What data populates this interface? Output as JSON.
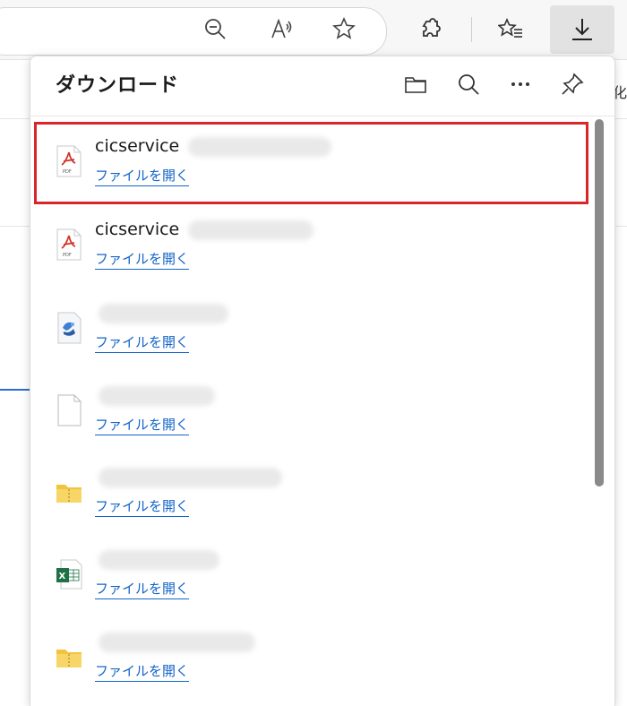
{
  "toolbar": {
    "icons": [
      "zoom-out-icon",
      "read-aloud-icon",
      "favorite-star-icon",
      "extensions-icon",
      "favorites-icon",
      "downloads-icon"
    ]
  },
  "background": {
    "partial_char": "化"
  },
  "panel": {
    "title": "ダウンロード",
    "header_icons": [
      "folder-icon",
      "search-icon",
      "more-icon",
      "pin-icon"
    ]
  },
  "downloads": [
    {
      "name": "cicservice",
      "type": "pdf",
      "open_label": "ファイルを開く",
      "highlighted": true
    },
    {
      "name": "cicservice",
      "type": "pdf",
      "open_label": "ファイルを開く",
      "highlighted": false
    },
    {
      "name": "",
      "type": "installer",
      "open_label": "ファイルを開く",
      "highlighted": false
    },
    {
      "name": "",
      "type": "generic",
      "open_label": "ファイルを開く",
      "highlighted": false
    },
    {
      "name": "",
      "type": "zip-folder",
      "open_label": "ファイルを開く",
      "highlighted": false
    },
    {
      "name": "",
      "type": "excel",
      "open_label": "ファイルを開く",
      "highlighted": false
    },
    {
      "name": "",
      "type": "zip-folder",
      "open_label": "ファイルを開く",
      "highlighted": false
    }
  ],
  "colors": {
    "link": "#1464c8",
    "highlight": "#d9262a",
    "pdf": "#d0362b",
    "excel": "#1e7145",
    "folder": "#f2c33d"
  }
}
